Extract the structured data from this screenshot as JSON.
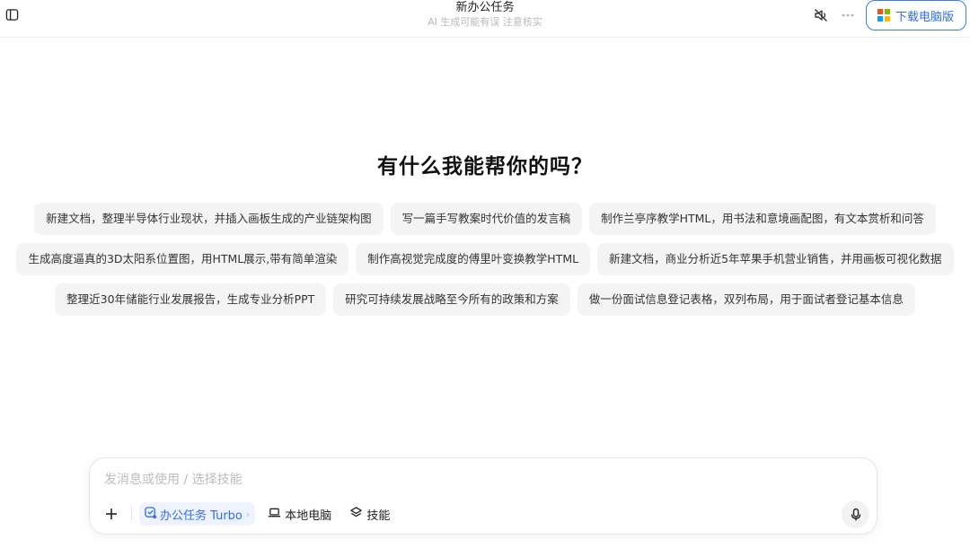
{
  "header": {
    "title": "新办公任务",
    "subtitle": "AI 生成可能有误 注意核实",
    "download_label": "下载电脑版"
  },
  "icons": {
    "sidebar_toggle": "sidebar-panel-icon",
    "mute": "speaker-muted-icon",
    "more": "more-horizontal-icon",
    "windows": "windows-logo-icon",
    "plus": "plus-icon",
    "skill": "office-task-icon",
    "laptop": "laptop-icon",
    "layers": "layers-icon",
    "mic": "microphone-icon"
  },
  "colors": {
    "accent": "#2f6bf0",
    "chip_bg": "#f4f4f5",
    "windows": [
      "#f25022",
      "#7fba00",
      "#00a4ef",
      "#ffb900"
    ]
  },
  "main": {
    "heading": "有什么我能帮你的吗？",
    "suggestion_rows": [
      [
        "新建文档，整理半导体行业现状，并插入画板生成的产业链架构图",
        "写一篇手写教案时代价值的发言稿",
        "制作兰亭序教学HTML，用书法和意境画配图，有文本赏析和问答"
      ],
      [
        "生成高度逼真的3D太阳系位置图，用HTML展示,带有简单渲染",
        "制作高视觉完成度的傅里叶变换教学HTML",
        "新建文档，商业分析近5年苹果手机营业销售，并用画板可视化数据"
      ],
      [
        "整理近30年储能行业发展报告，生成专业分析PPT",
        "研究可持续发展战略至今所有的政策和方案",
        "做一份面试信息登记表格，双列布局，用于面试者登记基本信息"
      ]
    ]
  },
  "composer": {
    "placeholder": "发消息或使用 / 选择技能",
    "value": "",
    "skill_label": "办公任务 Turbo",
    "skill_chevron": "›",
    "local_pc_label": "本地电脑",
    "skills_label": "技能"
  }
}
